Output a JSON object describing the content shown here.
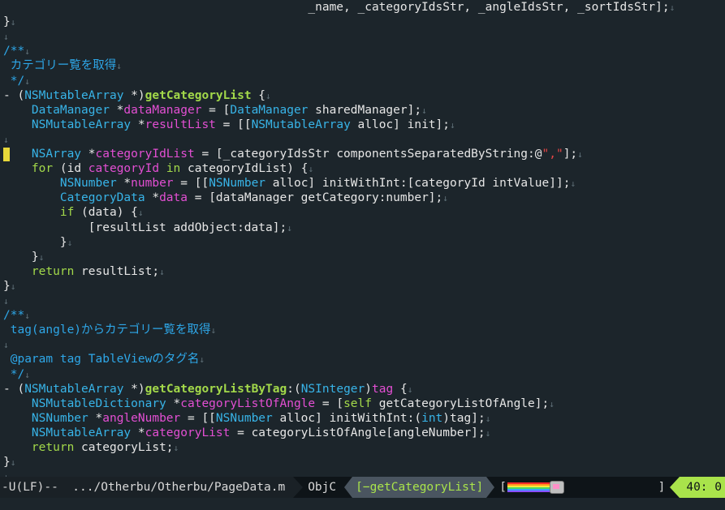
{
  "editor": {
    "lines": [
      [
        [
          "t-plain",
          "                                           _name, _categoryIdsStr, _angleIdsStr, _sortIdsStr];"
        ]
      ],
      [
        [
          "t-plain",
          "}"
        ]
      ],
      [],
      [
        [
          "t-comment",
          "/**"
        ]
      ],
      [
        [
          "t-comment",
          " カテゴリー覧を取得"
        ]
      ],
      [
        [
          "t-comment",
          " */"
        ]
      ],
      [
        [
          "t-plain",
          "- ("
        ],
        [
          "t-type",
          "NSMutableArray"
        ],
        [
          "t-plain",
          " *)"
        ],
        [
          "t-func",
          "getCategoryList"
        ],
        [
          "t-plain",
          " {"
        ]
      ],
      [
        [
          "t-plain",
          "    "
        ],
        [
          "t-type",
          "DataManager"
        ],
        [
          "t-plain",
          " *"
        ],
        [
          "t-var",
          "dataManager"
        ],
        [
          "t-plain",
          " = ["
        ],
        [
          "t-type",
          "DataManager"
        ],
        [
          "t-plain",
          " sharedManager];"
        ]
      ],
      [
        [
          "t-plain",
          "    "
        ],
        [
          "t-type",
          "NSMutableArray"
        ],
        [
          "t-plain",
          " *"
        ],
        [
          "t-var",
          "resultList"
        ],
        [
          "t-plain",
          " = [["
        ],
        [
          "t-type",
          "NSMutableArray"
        ],
        [
          "t-plain",
          " alloc] init];"
        ]
      ],
      [],
      [
        [
          "t-plain",
          "    "
        ],
        [
          "t-type",
          "NSArray"
        ],
        [
          "t-plain",
          " *"
        ],
        [
          "t-var",
          "categoryIdList"
        ],
        [
          "t-plain",
          " = [_categoryIdsStr componentsSeparatedByString:@"
        ],
        [
          "t-strlit",
          "\",\""
        ],
        [
          "t-plain",
          "];"
        ]
      ],
      [
        [
          "t-plain",
          "    "
        ],
        [
          "t-key",
          "for"
        ],
        [
          "t-plain",
          " (id "
        ],
        [
          "t-var",
          "categoryId"
        ],
        [
          "t-plain",
          " "
        ],
        [
          "t-key",
          "in"
        ],
        [
          "t-plain",
          " categoryIdList) {"
        ]
      ],
      [
        [
          "t-plain",
          "        "
        ],
        [
          "t-type",
          "NSNumber"
        ],
        [
          "t-plain",
          " *"
        ],
        [
          "t-var",
          "number"
        ],
        [
          "t-plain",
          " = [["
        ],
        [
          "t-type",
          "NSNumber"
        ],
        [
          "t-plain",
          " alloc] initWithInt:[categoryId intValue]];"
        ]
      ],
      [
        [
          "t-plain",
          "        "
        ],
        [
          "t-type",
          "CategoryData"
        ],
        [
          "t-plain",
          " *"
        ],
        [
          "t-var",
          "data"
        ],
        [
          "t-plain",
          " = [dataManager getCategory:number];"
        ]
      ],
      [
        [
          "t-plain",
          "        "
        ],
        [
          "t-key",
          "if"
        ],
        [
          "t-plain",
          " (data) {"
        ]
      ],
      [
        [
          "t-plain",
          "            [resultList addObject:data];"
        ]
      ],
      [
        [
          "t-plain",
          "        }"
        ]
      ],
      [
        [
          "t-plain",
          "    }"
        ]
      ],
      [
        [
          "t-plain",
          "    "
        ],
        [
          "t-key",
          "return"
        ],
        [
          "t-plain",
          " resultList;"
        ]
      ],
      [
        [
          "t-plain",
          "}"
        ]
      ],
      [],
      [
        [
          "t-comment",
          "/**"
        ]
      ],
      [
        [
          "t-comment",
          " tag(angle)からカテゴリー覧を取得"
        ]
      ],
      [],
      [
        [
          "t-comment",
          " @param tag TableViewのタグ名"
        ]
      ],
      [
        [
          "t-comment",
          " */"
        ]
      ],
      [
        [
          "t-plain",
          "- ("
        ],
        [
          "t-type",
          "NSMutableArray"
        ],
        [
          "t-plain",
          " *)"
        ],
        [
          "t-func",
          "getCategoryListByTag"
        ],
        [
          "t-plain",
          ":("
        ],
        [
          "t-type",
          "NSInteger"
        ],
        [
          "t-plain",
          ")"
        ],
        [
          "t-var",
          "tag"
        ],
        [
          "t-plain",
          " {"
        ]
      ],
      [
        [
          "t-plain",
          "    "
        ],
        [
          "t-type",
          "NSMutableDictionary"
        ],
        [
          "t-plain",
          " *"
        ],
        [
          "t-var",
          "categoryListOfAngle"
        ],
        [
          "t-plain",
          " = ["
        ],
        [
          "t-key",
          "self"
        ],
        [
          "t-plain",
          " getCategoryListOfAngle];"
        ]
      ],
      [
        [
          "t-plain",
          "    "
        ],
        [
          "t-type",
          "NSNumber"
        ],
        [
          "t-plain",
          " *"
        ],
        [
          "t-var",
          "angleNumber"
        ],
        [
          "t-plain",
          " = [["
        ],
        [
          "t-type",
          "NSNumber"
        ],
        [
          "t-plain",
          " alloc] initWithInt:("
        ],
        [
          "t-type",
          "int"
        ],
        [
          "t-plain",
          ")tag];"
        ]
      ],
      [
        [
          "t-plain",
          "    "
        ],
        [
          "t-type",
          "NSMutableArray"
        ],
        [
          "t-plain",
          " *"
        ],
        [
          "t-var",
          "categoryList"
        ],
        [
          "t-plain",
          " = categoryListOfAngle[angleNumber];"
        ]
      ],
      [
        [
          "t-plain",
          "    "
        ],
        [
          "t-key",
          "return"
        ],
        [
          "t-plain",
          " categoryList;"
        ]
      ],
      [
        [
          "t-plain",
          "}"
        ]
      ],
      []
    ],
    "newline_glyph": "↓"
  },
  "modeline": {
    "file": "-U(LF)--  .../Otherbu/Otherbu/PageData.m",
    "mode": "ObjC",
    "function": "[−getCategoryList]",
    "bar_open": "[",
    "bar_close": "]",
    "position": "40: 0"
  },
  "colors": {
    "background": "#1c252b",
    "cursor": "#e7d83a",
    "comment": "#2ea7e8",
    "type": "#38b4e8",
    "function": "#a3d94a",
    "variable": "#e34fd3",
    "modeline_accent": "#a9e34b"
  }
}
